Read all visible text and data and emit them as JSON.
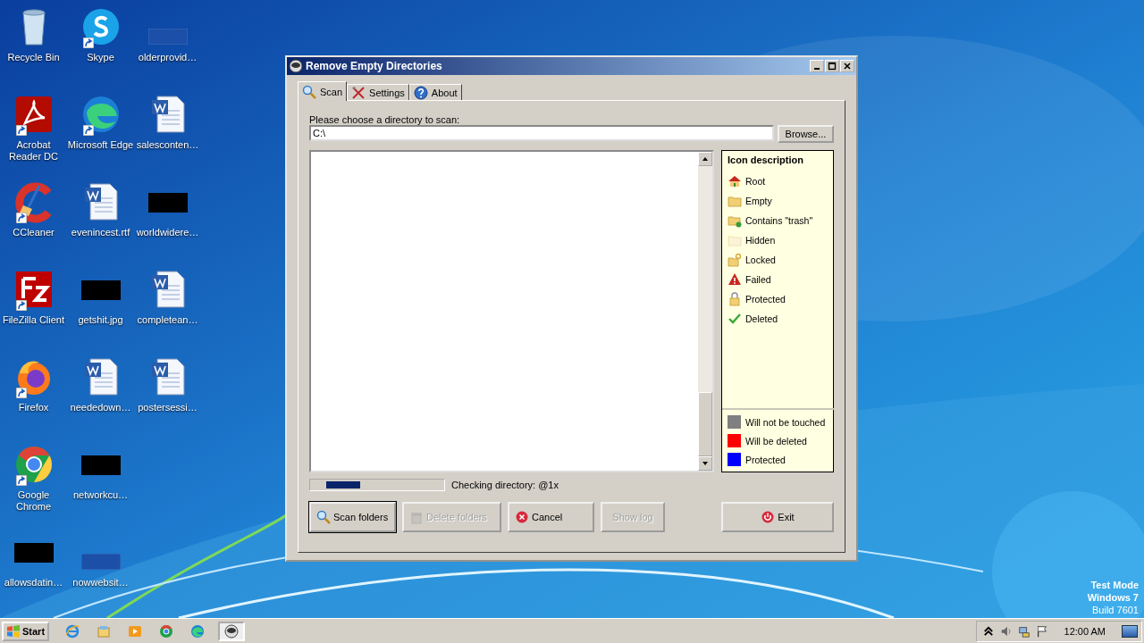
{
  "desktop": {
    "icons": [
      {
        "label": "Recycle Bin",
        "kind": "recycle",
        "shortcut": false
      },
      {
        "label": "Acrobat Reader DC",
        "kind": "acrobat",
        "shortcut": true
      },
      {
        "label": "CCleaner",
        "kind": "ccleaner",
        "shortcut": true
      },
      {
        "label": "FileZilla Client",
        "kind": "filezilla",
        "shortcut": true
      },
      {
        "label": "Firefox",
        "kind": "firefox",
        "shortcut": true
      },
      {
        "label": "Google Chrome",
        "kind": "chrome",
        "shortcut": true
      },
      {
        "label": "allowsdatin…",
        "kind": "black",
        "shortcut": false
      },
      {
        "label": "Skype",
        "kind": "skype",
        "shortcut": true
      },
      {
        "label": "Microsoft Edge",
        "kind": "edge",
        "shortcut": true
      },
      {
        "label": "evenincest.rtf",
        "kind": "word",
        "shortcut": false
      },
      {
        "label": "getshit.jpg",
        "kind": "black",
        "shortcut": false
      },
      {
        "label": "neededown…",
        "kind": "word",
        "shortcut": false
      },
      {
        "label": "networkcu…",
        "kind": "black",
        "shortcut": false
      },
      {
        "label": "nowwebsit…",
        "kind": "blank",
        "shortcut": false
      },
      {
        "label": "olderprovid…",
        "kind": "blank",
        "shortcut": false
      },
      {
        "label": "salesconten…",
        "kind": "word",
        "shortcut": false
      },
      {
        "label": "worldwidere…",
        "kind": "black",
        "shortcut": false
      },
      {
        "label": "completean…",
        "kind": "word",
        "shortcut": false
      },
      {
        "label": "postersessi…",
        "kind": "word",
        "shortcut": false
      }
    ],
    "watermark_os": [
      "Test Mode",
      "Windows 7",
      "Build 7601"
    ]
  },
  "window": {
    "title": "Remove Empty Directories",
    "tabs": [
      {
        "label": "Scan",
        "kind": "search",
        "selected": true
      },
      {
        "label": "Settings",
        "kind": "tools",
        "selected": false
      },
      {
        "label": "About",
        "kind": "help",
        "selected": false
      }
    ],
    "directory_label": "Please choose a directory to scan:",
    "directory_field": {
      "value": "C:\\"
    },
    "browse_button": "Browse...",
    "legend": {
      "title": "Icon description",
      "icons": [
        {
          "label": "Root",
          "kind": "root"
        },
        {
          "label": "Empty",
          "kind": "empty"
        },
        {
          "label": "Contains \"trash\"",
          "kind": "trash"
        },
        {
          "label": "Hidden",
          "kind": "hidden"
        },
        {
          "label": "Locked",
          "kind": "locked"
        },
        {
          "label": "Failed",
          "kind": "failed"
        },
        {
          "label": "Protected",
          "kind": "protected"
        },
        {
          "label": "Deleted",
          "kind": "deleted"
        }
      ],
      "colors": [
        {
          "label": "Will not be touched",
          "color": "#808080"
        },
        {
          "label": "Will be deleted",
          "color": "#ff0000"
        },
        {
          "label": "Protected",
          "color": "#0000ff"
        }
      ]
    },
    "progress": {
      "level": 0.25
    },
    "status": "Checking directory: @1x",
    "buttons": [
      {
        "label": "Scan folders",
        "kind": "search",
        "disabled": false,
        "default": true
      },
      {
        "label": "Delete folders",
        "kind": "bin",
        "disabled": true,
        "default": false
      },
      {
        "label": "Cancel",
        "kind": "cancel",
        "disabled": false,
        "default": false
      },
      {
        "label": "Show log",
        "kind": "none",
        "disabled": true,
        "default": false
      }
    ],
    "exit_button": {
      "label": "Exit",
      "kind": "exit",
      "disabled": false
    }
  },
  "taskbar": {
    "start": "Start",
    "apps": [
      {
        "kind": "ie",
        "selected": false
      },
      {
        "kind": "explorer",
        "selected": false
      },
      {
        "kind": "media",
        "selected": false
      },
      {
        "kind": "chrome",
        "selected": false
      },
      {
        "kind": "edge",
        "selected": false
      },
      {
        "kind": "app",
        "selected": true
      }
    ],
    "clock": "12:00 AM"
  }
}
